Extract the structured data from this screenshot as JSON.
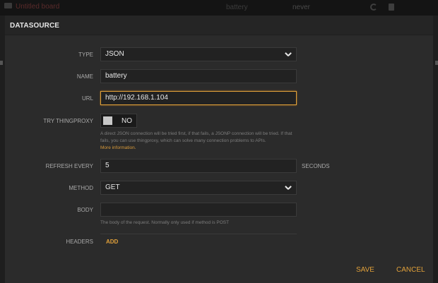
{
  "background": {
    "title": "Untitled board",
    "col1": "battery",
    "col2": "never"
  },
  "dialog": {
    "title": "DATASOURCE",
    "fields": {
      "type": {
        "label": "TYPE",
        "value": "JSON"
      },
      "name": {
        "label": "NAME",
        "value": "battery"
      },
      "url": {
        "label": "URL",
        "value": "http://192.168.1.104"
      },
      "thingproxy": {
        "label": "TRY THINGPROXY",
        "state": "NO",
        "help": "A direct JSON connection will be tried first, if that fails, a JSONP connection will be tried. If that fails, you can use thingproxy, which can solve many connection problems to APIs.",
        "help_link": "More information."
      },
      "refresh": {
        "label": "REFRESH EVERY",
        "value": "5",
        "suffix": "SECONDS"
      },
      "method": {
        "label": "METHOD",
        "value": "GET"
      },
      "body": {
        "label": "BODY",
        "value": "",
        "help": "The body of the request. Normally only used if method is POST"
      },
      "headers": {
        "label": "HEADERS",
        "add_label": "ADD"
      }
    },
    "save_label": "SAVE",
    "cancel_label": "CANCEL"
  },
  "colors": {
    "accent": "#e0a03a",
    "modal_bg": "#2b2b2b",
    "page_bg": "#1e1e1e"
  },
  "icons": [
    "folder-icon",
    "refresh-icon",
    "trash-icon",
    "chevron-down-icon"
  ]
}
